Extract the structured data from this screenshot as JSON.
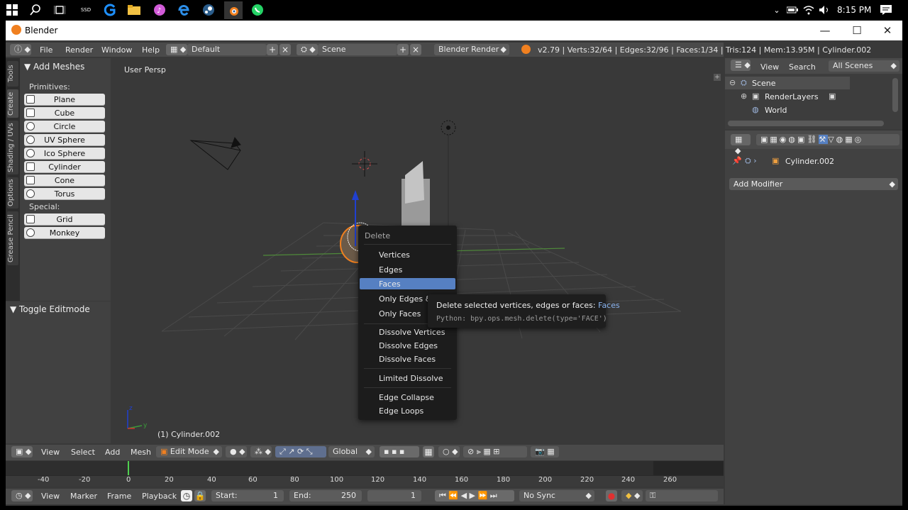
{
  "taskbar": {
    "time": "8:15 PM",
    "ssd_label": "SSD"
  },
  "window": {
    "title": "Blender",
    "minimize": "—",
    "maximize": "☐",
    "close": "✕"
  },
  "info_header": {
    "menus": [
      "File",
      "Render",
      "Window",
      "Help"
    ],
    "layout": "Default",
    "scene": "Scene",
    "engine": "Blender Render",
    "stats": "v2.79 | Verts:32/64 | Edges:32/96 | Faces:1/34 | Tris:124 | Mem:13.95M | Cylinder.002"
  },
  "tool_tabs": [
    "Tools",
    "Create",
    "Shading / UVs",
    "Options",
    "Grease Pencil"
  ],
  "tool_panel": {
    "header": "Add Meshes",
    "primitives_label": "Primitives:",
    "primitives": [
      "Plane",
      "Cube",
      "Circle",
      "UV Sphere",
      "Ico Sphere",
      "Cylinder",
      "Cone",
      "Torus"
    ],
    "special_label": "Special:",
    "special": [
      "Grid",
      "Monkey"
    ],
    "toggle_header": "Toggle Editmode"
  },
  "viewport": {
    "view_label": "User Persp",
    "object_label": "(1) Cylinder.002"
  },
  "delete_menu": {
    "title": "Delete",
    "items": [
      "Vertices",
      "Edges",
      "Faces",
      "Only Edges & Faces",
      "Only Faces",
      "Dissolve Vertices",
      "Dissolve Edges",
      "Dissolve Faces",
      "Limited Dissolve",
      "Edge Collapse",
      "Edge Loops"
    ],
    "selected": "Faces"
  },
  "tooltip": {
    "text": "Delete selected vertices, edges or faces:",
    "value": "Faces",
    "python": "Python: bpy.ops.mesh.delete(type='FACE')"
  },
  "view3d_header": {
    "menus": [
      "View",
      "Select",
      "Add",
      "Mesh"
    ],
    "mode": "Edit Mode",
    "orientation": "Global"
  },
  "timeline": {
    "ticks": [
      "-40",
      "-20",
      "0",
      "20",
      "40",
      "60",
      "80",
      "100",
      "120",
      "140",
      "160",
      "180",
      "200",
      "220",
      "240",
      "260"
    ],
    "menus": [
      "View",
      "Marker",
      "Frame",
      "Playback"
    ],
    "start_label": "Start:",
    "start_value": "1",
    "end_label": "End:",
    "end_value": "250",
    "current_frame": "1",
    "sync": "No Sync"
  },
  "outliner": {
    "menus": [
      "View",
      "Search"
    ],
    "filter": "All Scenes",
    "tree": [
      "Scene",
      "RenderLayers",
      "World"
    ]
  },
  "properties": {
    "object_name": "Cylinder.002",
    "add_modifier": "Add Modifier"
  },
  "colors": {
    "accent": "#5680c2",
    "panel": "#414141",
    "viewport": "#393939",
    "selected_orange": "#f08020"
  }
}
